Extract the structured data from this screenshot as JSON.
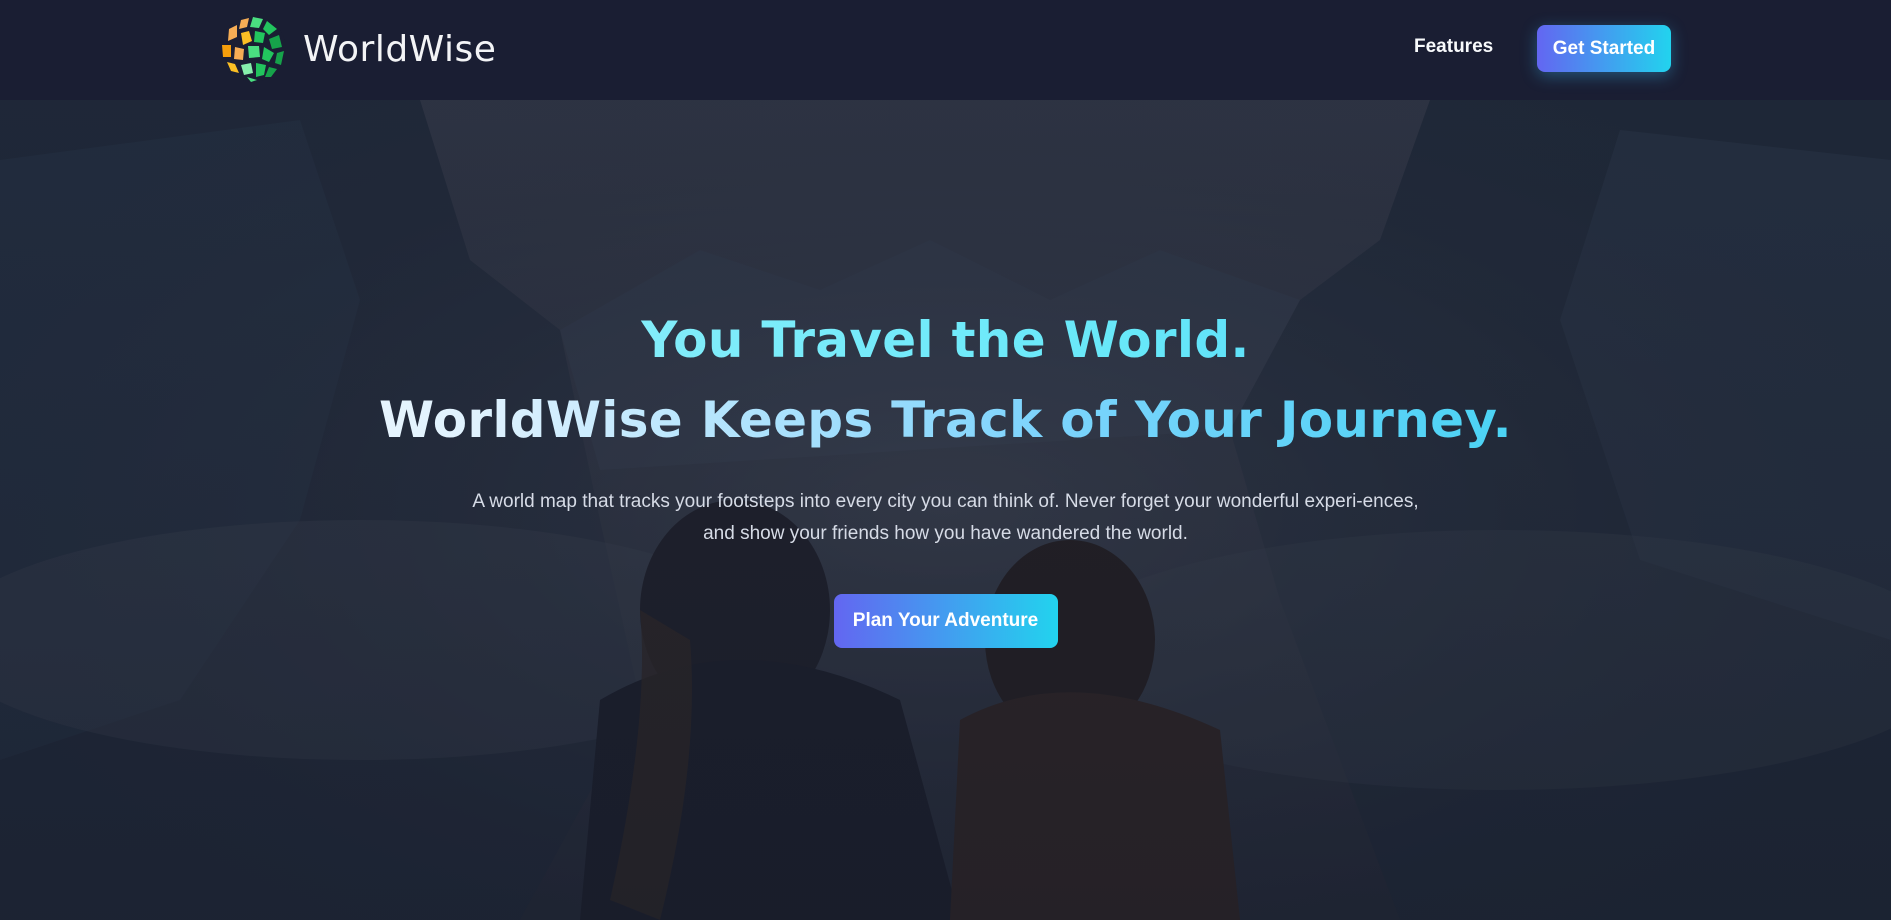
{
  "navbar": {
    "brand": "WorldWise",
    "logo_icon": "globe-mosaic-logo",
    "links": [
      {
        "label": "Features"
      }
    ],
    "cta_label": "Get Started"
  },
  "hero": {
    "headline_line1": "You Travel the World.",
    "headline_line2": "WorldWise Keeps Track of Your Journey.",
    "subtitle": "A world map that tracks your footsteps into every city you can think of. Never forget your wonderful experi-ences, and show your friends how you have wandered the world.",
    "cta_label": "Plan Your Adventure",
    "background_image": "two-travelers-facing-mountains-photo"
  },
  "colors": {
    "navbar_bg": "#1a1e33",
    "gradient_start": "#6366f1",
    "gradient_end": "#22d3ee",
    "heading_cyan": "#67e8f9",
    "logo_orange": "#f6ad55",
    "logo_green": "#22c55e"
  }
}
